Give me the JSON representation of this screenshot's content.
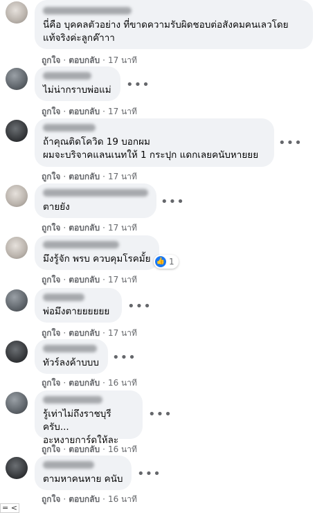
{
  "comments": [
    {
      "text": "นี่คือ บุคคลตัวอย่าง ที่ขาดความรับผิดชอบต่อสังคมคนเลวโดย\nแท้จริงค่ะลูกค๊าาา",
      "like": "ถูกใจ",
      "reply": "ตอบกลับ",
      "time": "17 นาที"
    },
    {
      "text": "ไม่น่ากราบพ่อแม่",
      "like": "ถูกใจ",
      "reply": "ตอบกลับ",
      "time": "17 นาที"
    },
    {
      "text": "ถ้าคุณติดโควิด 19 บอกผม\nผมจะบริจาคแลนเนทให้ 1 กระปุก แดกเลยคนับหายยย",
      "like": "ถูกใจ",
      "reply": "ตอบกลับ",
      "time": "17 นาที"
    },
    {
      "text": "ตายยัง",
      "like": "ถูกใจ",
      "reply": "ตอบกลับ",
      "time": "17 นาที"
    },
    {
      "text": "มึงรู้จัก พรบ ควบคุมโรคมั้ย",
      "reaction_count": "1",
      "like": "ถูกใจ",
      "reply": "ตอบกลับ",
      "time": "17 นาที"
    },
    {
      "text": "พ่อมึงตายยยยยย",
      "like": "ถูกใจ",
      "reply": "ตอบกลับ",
      "time": "17 นาที"
    },
    {
      "text": "ทัวร์ลงค้าบบบ",
      "like": "ถูกใจ",
      "reply": "ตอบกลับ",
      "time": "16 นาที"
    },
    {
      "text": "รู้เท่าไม่ถึงราชบุรีครับ...\nอะหงายการ์ดให้ละ",
      "like": "ถูกใจ",
      "reply": "ตอบกลับ",
      "time": "16 นาที"
    },
    {
      "text": "ตามหาคนหาย คนับ",
      "like": "ถูกใจ",
      "reply": "ตอบกลับ",
      "time": "16 นาที"
    }
  ],
  "more_icon": "more-options-icon",
  "corner_tag": "= <"
}
